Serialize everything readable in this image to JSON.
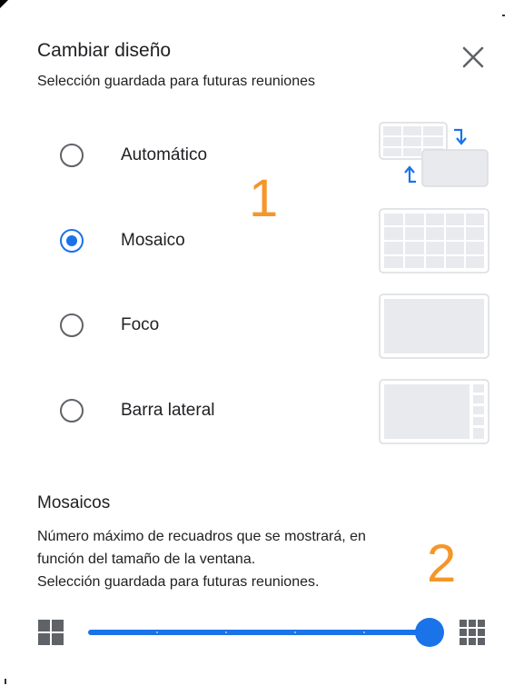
{
  "header": {
    "title": "Cambiar diseño",
    "subtitle": "Selección guardada para futuras reuniones",
    "close_icon": "close-icon"
  },
  "layout_options": [
    {
      "label": "Automático",
      "selected": false,
      "thumbnail": "auto-layout-thumbnail"
    },
    {
      "label": "Mosaico",
      "selected": true,
      "thumbnail": "tiled-layout-thumbnail"
    },
    {
      "label": "Foco",
      "selected": false,
      "thumbnail": "spotlight-layout-thumbnail"
    },
    {
      "label": "Barra lateral",
      "selected": false,
      "thumbnail": "sidebar-layout-thumbnail"
    }
  ],
  "annotations": {
    "one": "1",
    "two": "2"
  },
  "tiles_section": {
    "title": "Mosaicos",
    "description_line1": "Número máximo de recuadros que se mostrará, en",
    "description_line2": "función del tamaño de la ventana.",
    "description_line3": "Selección guardada para futuras reuniones."
  },
  "slider": {
    "min_icon": "grid-2x2-icon",
    "max_icon": "grid-3x3-icon",
    "steps": 6,
    "value_fraction": 1.0
  },
  "colors": {
    "accent": "#1a73e8",
    "annotation": "#f5962a",
    "thumbnail_fill": "#e8eaed",
    "thumbnail_border": "#dadce0"
  }
}
